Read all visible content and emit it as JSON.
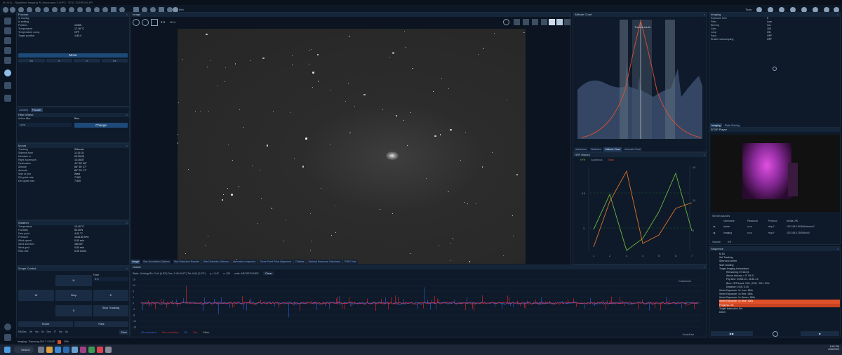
{
  "app": {
    "title": "N.I.N.A. - Nighttime Imaging 'N' Astronomy 3.1HF2 · ST11 SCHEDULER"
  },
  "toolbar": {
    "right_label": "Tools",
    "info_label": "Info"
  },
  "focuser": {
    "title": "Focuser",
    "rows": [
      {
        "k": "Is moving",
        "v": ""
      },
      {
        "k": "Is settling",
        "v": ""
      },
      {
        "k": "Position",
        "v": "12305"
      },
      {
        "k": "Temperature",
        "v": "17.16 °C"
      },
      {
        "k": "Temperature comp.",
        "v": "OFF"
      },
      {
        "k": "Target position",
        "v": "11614"
      }
    ],
    "move_label": "Move",
    "nav": [
      "<<",
      "<",
      ">",
      ">>"
    ]
  },
  "filterwheel": {
    "tabs": [
      "Camera",
      "Focuser"
    ],
    "title": "Filter Wheel",
    "active_filter_label": "Active filter",
    "active_filter_value": "Blue",
    "select_value": "Lum",
    "change_label": "Change"
  },
  "mount": {
    "title": "Mount",
    "rows": [
      {
        "k": "Tracking",
        "v": "Sidereal"
      },
      {
        "k": "Sidereal time",
        "v": "11:11:02"
      },
      {
        "k": "Meridian in",
        "v": "02:05:26"
      },
      {
        "k": "Right Ascension",
        "v": "13:16:57"
      },
      {
        "k": "Declination",
        "v": "41° 55' 38\""
      },
      {
        "k": "Altitude",
        "v": "66° 55' 27\""
      },
      {
        "k": "Azimuth",
        "v": "80° 20' 17\""
      },
      {
        "k": "Side of pier",
        "v": "West"
      },
      {
        "k": "RA guide rate",
        "v": "7.500"
      },
      {
        "k": "Dec guide rate",
        "v": "7.500"
      }
    ]
  },
  "weather": {
    "title": "Weather",
    "rows": [
      {
        "k": "Temperature",
        "v": "13.40 °C"
      },
      {
        "k": "Humidity",
        "v": "53.00%"
      },
      {
        "k": "Dew point",
        "v": "4.00 °C"
      },
      {
        "k": "Pressure",
        "v": "1016.60 hPa"
      },
      {
        "k": "Wind speed",
        "v": "0.00 m/s"
      },
      {
        "k": "Wind direction",
        "v": "180.00°"
      },
      {
        "k": "Wind gust",
        "v": "0.50 m/s"
      },
      {
        "k": "Rain rate",
        "v": "0.00 mm/h"
      }
    ]
  },
  "scope": {
    "title": "Scope Control",
    "rate_label": "Rate",
    "rate_value": "4.5",
    "n": "N",
    "w": "W",
    "stop": "Stop",
    "e": "E",
    "s": "S",
    "stop_tracking": "Stop Tracking",
    "home": "Home",
    "park": "Park",
    "slew": "Slew",
    "fields": [
      "RA/Dec",
      "4h",
      "0m",
      "0s",
      "Dec",
      "0°",
      "0m",
      "0s"
    ]
  },
  "image": {
    "title": "Image",
    "zoom": "1:1",
    "zoom_pct": "26 %",
    "tabs": [
      "Image",
      "Star Annotation Options",
      "Star Detection Results",
      "Star Detection Options",
      "Aberration Inspector",
      "Three Point Polar Alignment",
      "Orbitals",
      "Optimal Exposure Calculator",
      "PHD2 Info"
    ]
  },
  "altitude": {
    "title": "Altitude Chart",
    "transit_label": "Transit south",
    "tabs": [
      "Autofocus",
      "Statistics",
      "Altitude Chart",
      "Azimuth Chart"
    ]
  },
  "hfr": {
    "title": "HFR History",
    "legend": [
      "HFR",
      "Autofocus",
      "Stars"
    ],
    "x_ticks": [
      "1",
      "2",
      "3",
      "4",
      "5",
      "6",
      "7"
    ],
    "left_ticks": [
      "6.5",
      "3"
    ],
    "right_ticks": [
      "15",
      "10",
      "5"
    ]
  },
  "imaging": {
    "title": "Imaging",
    "rows": [
      {
        "k": "Exposure time",
        "v": "5"
      },
      {
        "k": "Filter",
        "v": "Lum"
      },
      {
        "k": "Binning",
        "v": "1x1"
      },
      {
        "k": "Gain",
        "v": "100"
      },
      {
        "k": "Loop",
        "v": "ON"
      },
      {
        "k": "Save",
        "v": "OFF"
      },
      {
        "k": "Enable subsampling",
        "v": "OFF"
      }
    ],
    "tabs": [
      "Imaging",
      "Plate Solving"
    ]
  },
  "rtsp": {
    "title": "RTSP Player",
    "stream_sources": "Stream sources",
    "headers": [
      "Username",
      "Password",
      "Protocol",
      "Media URL"
    ],
    "sources": [
      {
        "user": "admin",
        "pass": "••••••",
        "proto": "rtsp://",
        "url": "192.168.0.80/554/stream2"
      },
      {
        "user": "Imaging",
        "pass": "••••••",
        "proto": "rtsp://",
        "url": "192.168.0.25/554/ch0"
      }
    ],
    "volume_label": "Volume",
    "volume_value": "0%"
  },
  "guider": {
    "title": "Guider",
    "status": "State: Guiding  RA: 0.44 (0.53\")  Dec: 0.46 (0.57\")  Tot: 0.64 (0.79\")",
    "y_scale": "y: +/-16\"",
    "x_scale": "x: 100",
    "units": "units: ARCSECONDS",
    "clear": "Clear",
    "y_ticks": [
      "16",
      "12",
      "8",
      "4",
      "0",
      "-4",
      "-8",
      "-12",
      "-16"
    ],
    "legend": [
      "RA corrections",
      "Dec corrections",
      "RA",
      "Dec",
      "Dither"
    ],
    "guide_north": "GuideNorth",
    "guide_east": "GuideEast"
  },
  "sequence": {
    "title": "Sequence",
    "items": [
      "M 63",
      "Set Tracking",
      "Slew and center",
      "Start Guiding",
      "Target Imaging Instructions",
      "Remaining: 07:16:04",
      "Above Horizon > 0° 09:17",
      "Flip time: 23:56:14 - 06:51:14",
      "Blue: HFR trend: 3.01 | 0.00 - 3% / 10%",
      "Distance: 0.53 / 3.30",
      "Smart Exposure: 1x Lum: 180s",
      "Smart Exposure: 1x Red: 180s",
      "Smart Exposure: 1x Green: 180s",
      "Smart Exposure: 1x Blue: 180s",
      "Progress: 0/1",
      "Target Instruction Set",
      "Dither"
    ]
  },
  "status_bar": {
    "text": "Imaging · Exposing 00:17 / 03:00",
    "pct": "15%"
  },
  "taskbar": {
    "search": "Search",
    "time": "8:45 PM",
    "date": "4/26/2025"
  },
  "colors": {
    "accent": "#1d4a78",
    "highlight": "#e0502a",
    "hfr_green": "#6db33f",
    "hfr_orange": "#e0742a",
    "guide_ra": "#3a6be0",
    "guide_dec": "#e02a3a",
    "alt_curve": "#e0502a"
  }
}
